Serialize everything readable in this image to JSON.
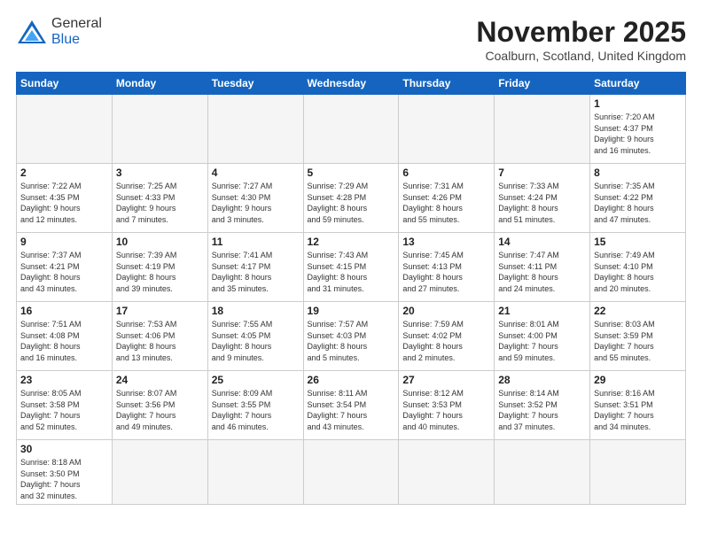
{
  "header": {
    "logo_general": "General",
    "logo_blue": "Blue",
    "month_title": "November 2025",
    "location": "Coalburn, Scotland, United Kingdom"
  },
  "weekdays": [
    "Sunday",
    "Monday",
    "Tuesday",
    "Wednesday",
    "Thursday",
    "Friday",
    "Saturday"
  ],
  "days": [
    {
      "num": "",
      "info": "",
      "empty": true
    },
    {
      "num": "",
      "info": "",
      "empty": true
    },
    {
      "num": "",
      "info": "",
      "empty": true
    },
    {
      "num": "",
      "info": "",
      "empty": true
    },
    {
      "num": "",
      "info": "",
      "empty": true
    },
    {
      "num": "",
      "info": "",
      "empty": true
    },
    {
      "num": "1",
      "info": "Sunrise: 7:20 AM\nSunset: 4:37 PM\nDaylight: 9 hours\nand 16 minutes."
    },
    {
      "num": "2",
      "info": "Sunrise: 7:22 AM\nSunset: 4:35 PM\nDaylight: 9 hours\nand 12 minutes."
    },
    {
      "num": "3",
      "info": "Sunrise: 7:25 AM\nSunset: 4:33 PM\nDaylight: 9 hours\nand 7 minutes."
    },
    {
      "num": "4",
      "info": "Sunrise: 7:27 AM\nSunset: 4:30 PM\nDaylight: 9 hours\nand 3 minutes."
    },
    {
      "num": "5",
      "info": "Sunrise: 7:29 AM\nSunset: 4:28 PM\nDaylight: 8 hours\nand 59 minutes."
    },
    {
      "num": "6",
      "info": "Sunrise: 7:31 AM\nSunset: 4:26 PM\nDaylight: 8 hours\nand 55 minutes."
    },
    {
      "num": "7",
      "info": "Sunrise: 7:33 AM\nSunset: 4:24 PM\nDaylight: 8 hours\nand 51 minutes."
    },
    {
      "num": "8",
      "info": "Sunrise: 7:35 AM\nSunset: 4:22 PM\nDaylight: 8 hours\nand 47 minutes."
    },
    {
      "num": "9",
      "info": "Sunrise: 7:37 AM\nSunset: 4:21 PM\nDaylight: 8 hours\nand 43 minutes."
    },
    {
      "num": "10",
      "info": "Sunrise: 7:39 AM\nSunset: 4:19 PM\nDaylight: 8 hours\nand 39 minutes."
    },
    {
      "num": "11",
      "info": "Sunrise: 7:41 AM\nSunset: 4:17 PM\nDaylight: 8 hours\nand 35 minutes."
    },
    {
      "num": "12",
      "info": "Sunrise: 7:43 AM\nSunset: 4:15 PM\nDaylight: 8 hours\nand 31 minutes."
    },
    {
      "num": "13",
      "info": "Sunrise: 7:45 AM\nSunset: 4:13 PM\nDaylight: 8 hours\nand 27 minutes."
    },
    {
      "num": "14",
      "info": "Sunrise: 7:47 AM\nSunset: 4:11 PM\nDaylight: 8 hours\nand 24 minutes."
    },
    {
      "num": "15",
      "info": "Sunrise: 7:49 AM\nSunset: 4:10 PM\nDaylight: 8 hours\nand 20 minutes."
    },
    {
      "num": "16",
      "info": "Sunrise: 7:51 AM\nSunset: 4:08 PM\nDaylight: 8 hours\nand 16 minutes."
    },
    {
      "num": "17",
      "info": "Sunrise: 7:53 AM\nSunset: 4:06 PM\nDaylight: 8 hours\nand 13 minutes."
    },
    {
      "num": "18",
      "info": "Sunrise: 7:55 AM\nSunset: 4:05 PM\nDaylight: 8 hours\nand 9 minutes."
    },
    {
      "num": "19",
      "info": "Sunrise: 7:57 AM\nSunset: 4:03 PM\nDaylight: 8 hours\nand 5 minutes."
    },
    {
      "num": "20",
      "info": "Sunrise: 7:59 AM\nSunset: 4:02 PM\nDaylight: 8 hours\nand 2 minutes."
    },
    {
      "num": "21",
      "info": "Sunrise: 8:01 AM\nSunset: 4:00 PM\nDaylight: 7 hours\nand 59 minutes."
    },
    {
      "num": "22",
      "info": "Sunrise: 8:03 AM\nSunset: 3:59 PM\nDaylight: 7 hours\nand 55 minutes."
    },
    {
      "num": "23",
      "info": "Sunrise: 8:05 AM\nSunset: 3:58 PM\nDaylight: 7 hours\nand 52 minutes."
    },
    {
      "num": "24",
      "info": "Sunrise: 8:07 AM\nSunset: 3:56 PM\nDaylight: 7 hours\nand 49 minutes."
    },
    {
      "num": "25",
      "info": "Sunrise: 8:09 AM\nSunset: 3:55 PM\nDaylight: 7 hours\nand 46 minutes."
    },
    {
      "num": "26",
      "info": "Sunrise: 8:11 AM\nSunset: 3:54 PM\nDaylight: 7 hours\nand 43 minutes."
    },
    {
      "num": "27",
      "info": "Sunrise: 8:12 AM\nSunset: 3:53 PM\nDaylight: 7 hours\nand 40 minutes."
    },
    {
      "num": "28",
      "info": "Sunrise: 8:14 AM\nSunset: 3:52 PM\nDaylight: 7 hours\nand 37 minutes."
    },
    {
      "num": "29",
      "info": "Sunrise: 8:16 AM\nSunset: 3:51 PM\nDaylight: 7 hours\nand 34 minutes."
    },
    {
      "num": "30",
      "info": "Sunrise: 8:18 AM\nSunset: 3:50 PM\nDaylight: 7 hours\nand 32 minutes."
    },
    {
      "num": "",
      "info": "",
      "empty": true
    },
    {
      "num": "",
      "info": "",
      "empty": true
    },
    {
      "num": "",
      "info": "",
      "empty": true
    },
    {
      "num": "",
      "info": "",
      "empty": true
    },
    {
      "num": "",
      "info": "",
      "empty": true
    },
    {
      "num": "",
      "info": "",
      "empty": true
    }
  ]
}
